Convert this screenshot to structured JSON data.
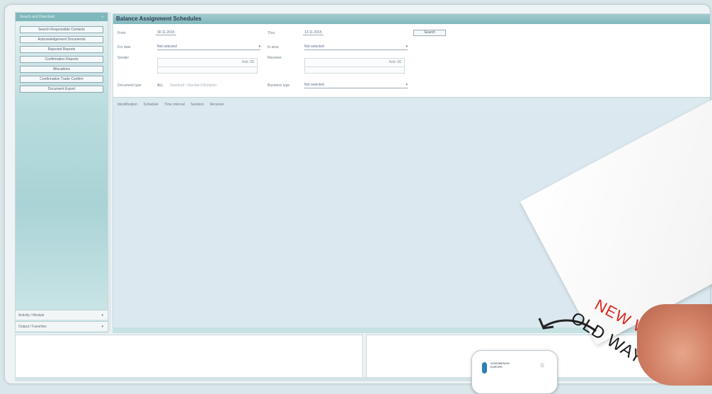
{
  "sidebar": {
    "header": "Search and Download",
    "toggle": "«",
    "items": [
      "Search Responsible Contacts",
      "Acknowledgement Documents",
      "Rejected Reports",
      "Confirmation Reports",
      "Allocations",
      "Confirmation Trade Confirm",
      "Document Export"
    ],
    "sections": [
      {
        "label": "Activity / Module",
        "arrow": "▾"
      },
      {
        "label": "Output / Favorites",
        "arrow": "▾"
      }
    ]
  },
  "main": {
    "title": "Balance Assignment Schedules",
    "filters": {
      "from_label": "From",
      "from_value": "30.11.2015",
      "to_label": "Thru",
      "to_value": "13.11.2015",
      "search_button": "Search",
      "for_date_label": "For date",
      "for_date_value": "Not selected",
      "in_area_label": "In area",
      "in_area_value": "Not selected",
      "sender_label": "Sender",
      "receiver_label": "Receiver",
      "document_type_label": "Document type",
      "document_type_value": "ALL",
      "document_type_note": "Standard / Standard Multiplier",
      "business_type_label": "Business type",
      "business_type_value": "Not selected",
      "multi_ctrl": "Add  ⌫"
    },
    "tabs": [
      "Identification",
      "Schedule",
      "Time interval",
      "Senders",
      "Receiver"
    ]
  },
  "promo": {
    "new_text": "NEW WAY",
    "old_text": "OLD WAY",
    "phone_text": "SONOMENON EUROPE",
    "phone_menu": "☰"
  }
}
